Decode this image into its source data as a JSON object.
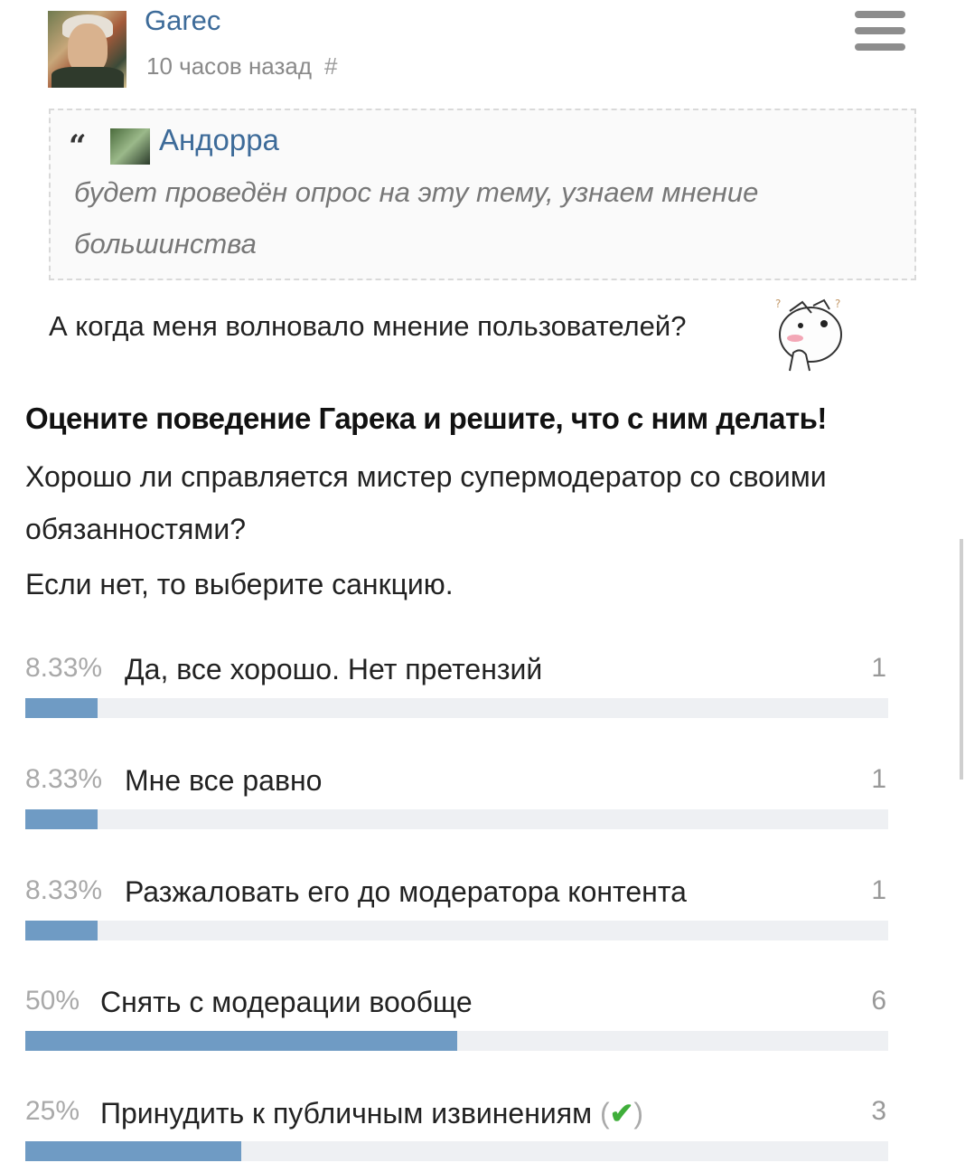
{
  "post": {
    "username": "Garec",
    "timestamp": "10 часов назад",
    "permalink": "#"
  },
  "quote": {
    "mark": "“",
    "author": "Андорра",
    "text": "будет проведён опрос на эту тему, узнаем мнение большинства"
  },
  "reply_text": "А когда меня волновало мнение пользователей?",
  "poll": {
    "title": "Оцените поведение Гарека и решите, что с ним делать!",
    "description": "Хорошо ли справляется мистер супермодератор со своими обязанностями?",
    "description2": "Если нет, то выберите санкцию.",
    "options": [
      {
        "percent": "8.33%",
        "label": "Да, все хорошо. Нет претензий",
        "count": "1",
        "fraction": 0.0833
      },
      {
        "percent": "8.33%",
        "label": "Мне все равно",
        "count": "1",
        "fraction": 0.0833
      },
      {
        "percent": "8.33%",
        "label": "Разжаловать его до модератора контента",
        "count": "1",
        "fraction": 0.0833
      },
      {
        "percent": "50%",
        "label": "Снять с модерации вообще",
        "count": "6",
        "fraction": 0.5
      },
      {
        "percent": "25%",
        "label": "Принудить к публичным извинениям",
        "count": "3",
        "fraction": 0.25,
        "voted": true
      }
    ],
    "bar_color": "#6f9bc4",
    "track_color": "#eef0f3"
  },
  "colors": {
    "link": "#3d6b99",
    "check": "#3fae3a"
  }
}
